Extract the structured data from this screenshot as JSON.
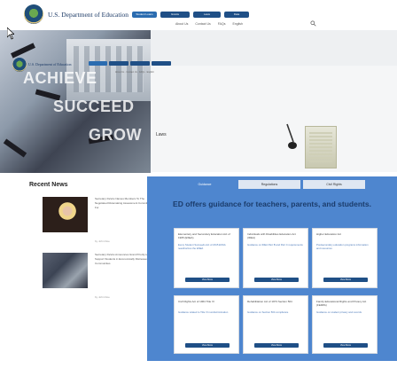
{
  "header": {
    "site_title": "U.S. Department of Education",
    "nav": [
      "Student Loans",
      "Grants",
      "Laws",
      "Data"
    ],
    "util": [
      "About Us",
      "Contact Us",
      "FAQs",
      "English"
    ]
  },
  "hero": {
    "words": [
      "ACHIEVE",
      "SUCCEED",
      "GROW"
    ]
  },
  "mini": {
    "site_title": "U.S. Department of Education",
    "util": "About Us · Contact Us · FAQs · English",
    "laws_label": "Laws"
  },
  "recent_news": {
    "title": "Recent News",
    "items": [
      {
        "text": "Secretary DeVos Names Members To The Negotiated Rulemaking Assessment Committee For",
        "by": "by John Doe"
      },
      {
        "text": "Secretary DeVos Announces Grant Priority to Support Students in Economically Distressed Communities",
        "by": "by John Doe"
      }
    ]
  },
  "panel": {
    "tabs": [
      "Guidance",
      "Regulations",
      "Civil Rights"
    ],
    "active_tab": "Guidance",
    "heading": "ED offers guidance for teachers, parents, and students.",
    "cards": [
      {
        "title": "Elementary and Secondary Education Act of 1965 (ESEA)",
        "text": "Every Student Succeeds Act of 2015 ESSA reauthorizes the ESEA",
        "button": "View More"
      },
      {
        "title": "Individuals with Disabilities Education Act (IDEA)",
        "text": "Guidance on IDEA Part B and Part C requirements",
        "button": "View More"
      },
      {
        "title": "Higher Education Act",
        "text": "Postsecondary education programs information and resources",
        "button": "View More"
      },
      {
        "title": "Civil Rights Act of 1964 Title VI",
        "text": "Guidance related to Title VI nondiscrimination",
        "button": "View More"
      },
      {
        "title": "Rehabilitation Act of 1973 Section 504",
        "text": "Guidance on Section 504 compliance",
        "button": "View More"
      },
      {
        "title": "Family Educational Rights and Privacy Act (FERPA)",
        "text": "Guidance on student privacy and records",
        "button": "View More"
      }
    ]
  },
  "colors": {
    "brand_navy": "#1f4f86",
    "panel_blue": "#4e86cf"
  }
}
